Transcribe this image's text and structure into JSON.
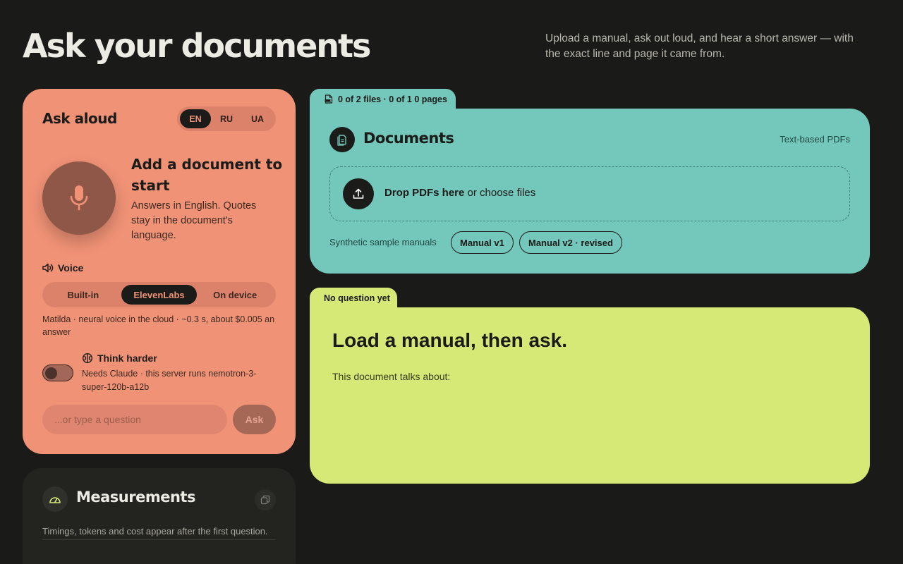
{
  "header": {
    "title": "Ask your documents",
    "subtitle": "Upload a manual, ask out loud, and hear a short answer — with the exact line and page it came from."
  },
  "ask": {
    "title": "Ask aloud",
    "languages": [
      "EN",
      "RU",
      "UA"
    ],
    "active_language": "EN",
    "cta_title": "Add a document to start",
    "cta_sub": "Answers in English. Quotes stay in the document's language.",
    "voice_label": "Voice",
    "voice_options": [
      "Built-in",
      "ElevenLabs",
      "On device"
    ],
    "active_voice": "ElevenLabs",
    "voice_desc": "Matilda · neural voice in the cloud · ~0.3 s, about $0.005 an answer",
    "think_label": "Think harder",
    "think_desc": "Needs Claude · this server runs nemotron-3-super-120b-a12b",
    "think_enabled": false,
    "input_placeholder": "...or type a question",
    "ask_button": "Ask"
  },
  "measurements": {
    "title": "Measurements",
    "desc": "Timings, tokens and cost appear after the first question."
  },
  "documents": {
    "tab_label": "0 of 2 files · 0 of 1 0 pages",
    "title": "Documents",
    "hint": "Text-based PDFs",
    "drop_bold": "Drop PDFs here",
    "drop_rest": " or choose files",
    "samples_label": "Synthetic sample manuals",
    "samples": [
      "Manual v1",
      "Manual v2 · revised"
    ]
  },
  "answer": {
    "tab_label": "No question yet",
    "title": "Load a manual, then ask.",
    "sub": "This document talks about:"
  },
  "colors": {
    "background": "#1a1a18",
    "ask_card": "#f09276",
    "documents_card": "#73c7bb",
    "answer_card": "#d6e977",
    "measurements_card": "#232420"
  }
}
